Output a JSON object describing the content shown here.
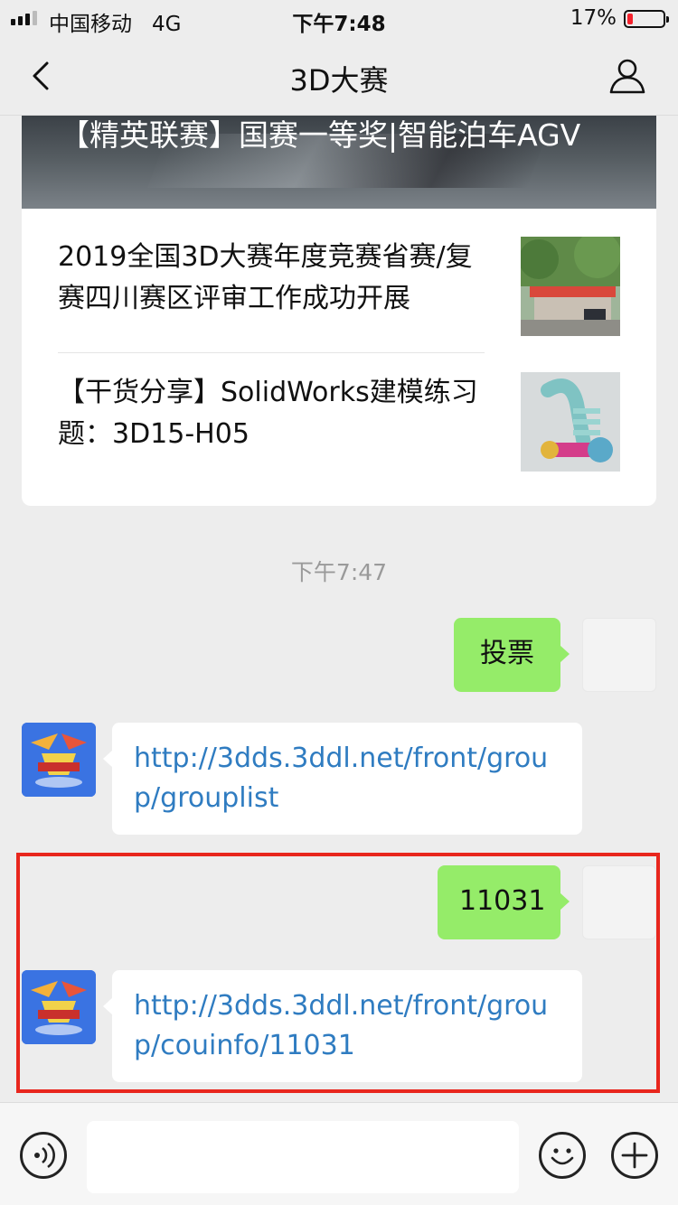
{
  "status_bar": {
    "carrier": "中国移动",
    "network": "4G",
    "time": "下午7:48",
    "battery_percent": "17%",
    "battery_level": 0.17,
    "battery_color": "#f5222d"
  },
  "nav": {
    "title": "3D大赛",
    "back_icon": "chevron-left-icon",
    "profile_icon": "person-icon"
  },
  "article_card": {
    "cover_title": "【精英联赛】国赛一等奖|智能泊车AGV",
    "items": [
      {
        "title": "2019全国3D大赛年度竞赛省赛/复赛四川赛区评审工作成功开展"
      },
      {
        "title": "【干货分享】SolidWorks建模练习题：3D15-H05"
      }
    ]
  },
  "chat": {
    "timestamp": "下午7:47",
    "messages": [
      {
        "from": "self",
        "text": "投票"
      },
      {
        "from": "bot",
        "text": "http://3dds.3ddl.net/front/group/grouplist"
      },
      {
        "from": "self",
        "text": "11031"
      },
      {
        "from": "bot",
        "text": "http://3dds.3ddl.net/front/group/couinfo/11031"
      }
    ],
    "bubble_colors": {
      "self": "#95ec69",
      "bot": "#ffffff",
      "link": "#2f7cc1"
    },
    "highlight_color": "#e8261d"
  },
  "input_bar": {
    "voice_icon": "voice-icon",
    "emoji_icon": "emoji-icon",
    "plus_icon": "plus-icon"
  }
}
